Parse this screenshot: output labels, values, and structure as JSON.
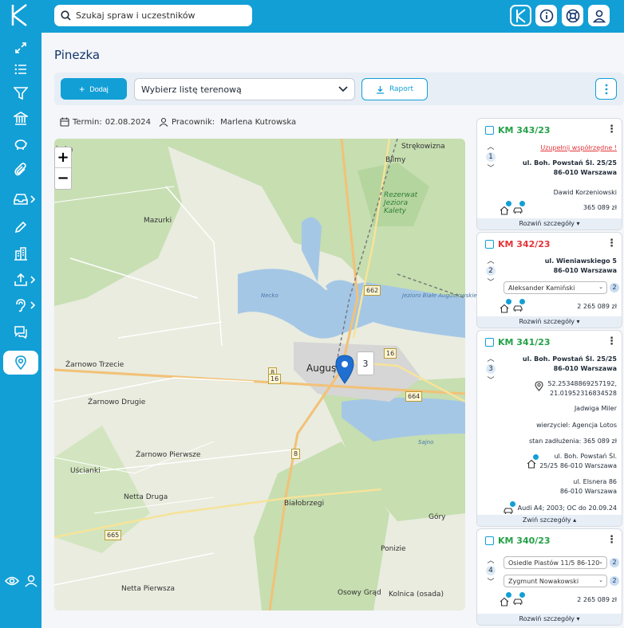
{
  "search": {
    "placeholder": "Szukaj spraw i uczestników"
  },
  "page": {
    "title": "Pinezka"
  },
  "toolbar": {
    "add_label": "Dodaj",
    "select_value": "Wybierz listę terenową",
    "report_label": "Raport"
  },
  "meta": {
    "term_label": "Termin:",
    "term_value": "02.08.2024",
    "worker_label": "Pracownik:",
    "worker_value": "Marlena Kutrowska"
  },
  "map": {
    "cluster_count": "3",
    "labels": [
      "Mazurki",
      "Strękowizna",
      "Bilmy",
      "Rezerwat Jeziora Kalety",
      "Necko",
      "Jezioro Białe Augustowskie",
      "Augustów",
      "Żarnowo Trzecie",
      "Żarnowo Drugie",
      "Żarnowo Pierwsze",
      "Uścianki",
      "Netta Druga",
      "Białobrzegi",
      "Netta Pierwsza",
      "Osowy Grąd",
      "Kolnica (osada)",
      "Ponizie",
      "Góry",
      "Sajno",
      "ówka"
    ],
    "roads": [
      "662",
      "16",
      "664",
      "8",
      "16",
      "8",
      "665"
    ]
  },
  "cards": [
    {
      "case": "KM 343/23",
      "status": "green",
      "num": "1",
      "warning": "Uzupełnij współrzędne !",
      "address1": "ul. Boh. Powstań Śl. 25/25",
      "address2": "86-010 Warszawa",
      "person": "Dawid Korzeniowski",
      "amount": "365 089 zł",
      "footer": "Rozwiń szczegóły"
    },
    {
      "case": "KM 342/23",
      "status": "red",
      "num": "2",
      "address1": "ul. Wieniawskiego 5",
      "address2": "86-010 Warszawa",
      "person_select": "Aleksander Kamiński",
      "person_count": "2",
      "amount": "2 265 089 zł",
      "footer": "Rozwiń szczegóły"
    },
    {
      "case": "KM 341/23",
      "status": "green",
      "num": "3",
      "address1": "ul. Boh. Powstań Śl. 25/25",
      "address2": "86-010 Warszawa",
      "coords1": "52.25348869257192,",
      "coords2": "21.01952316834528",
      "person": "Jadwiga Miler",
      "creditor": "wierzyciel: Agencja Lotos",
      "debt": "stan zadłużenia: 365 089 zł",
      "prop1a": "ul. Boh. Powstań Śl.",
      "prop1b": "25/25 86-010 Warszawa",
      "prop2a": "ul. Elsnera 86",
      "prop2b": "86-010 Warszawa",
      "vehicle": "Audi A4; 2003; OC do 20.09.24",
      "footer": "Zwiń szczegóły"
    },
    {
      "case": "KM 340/23",
      "status": "green",
      "num": "4",
      "address_select": "Osiedle Piastów 11/5 86-120",
      "address_count": "2",
      "person_select": "Zygmunt Nowakowski",
      "person_count": "2",
      "amount": "2 265 089 zł",
      "footer": "Rozwiń szczegóły"
    }
  ],
  "colors": {
    "brand": "#129fd6",
    "green": "#24a148",
    "red": "#e5343a"
  }
}
